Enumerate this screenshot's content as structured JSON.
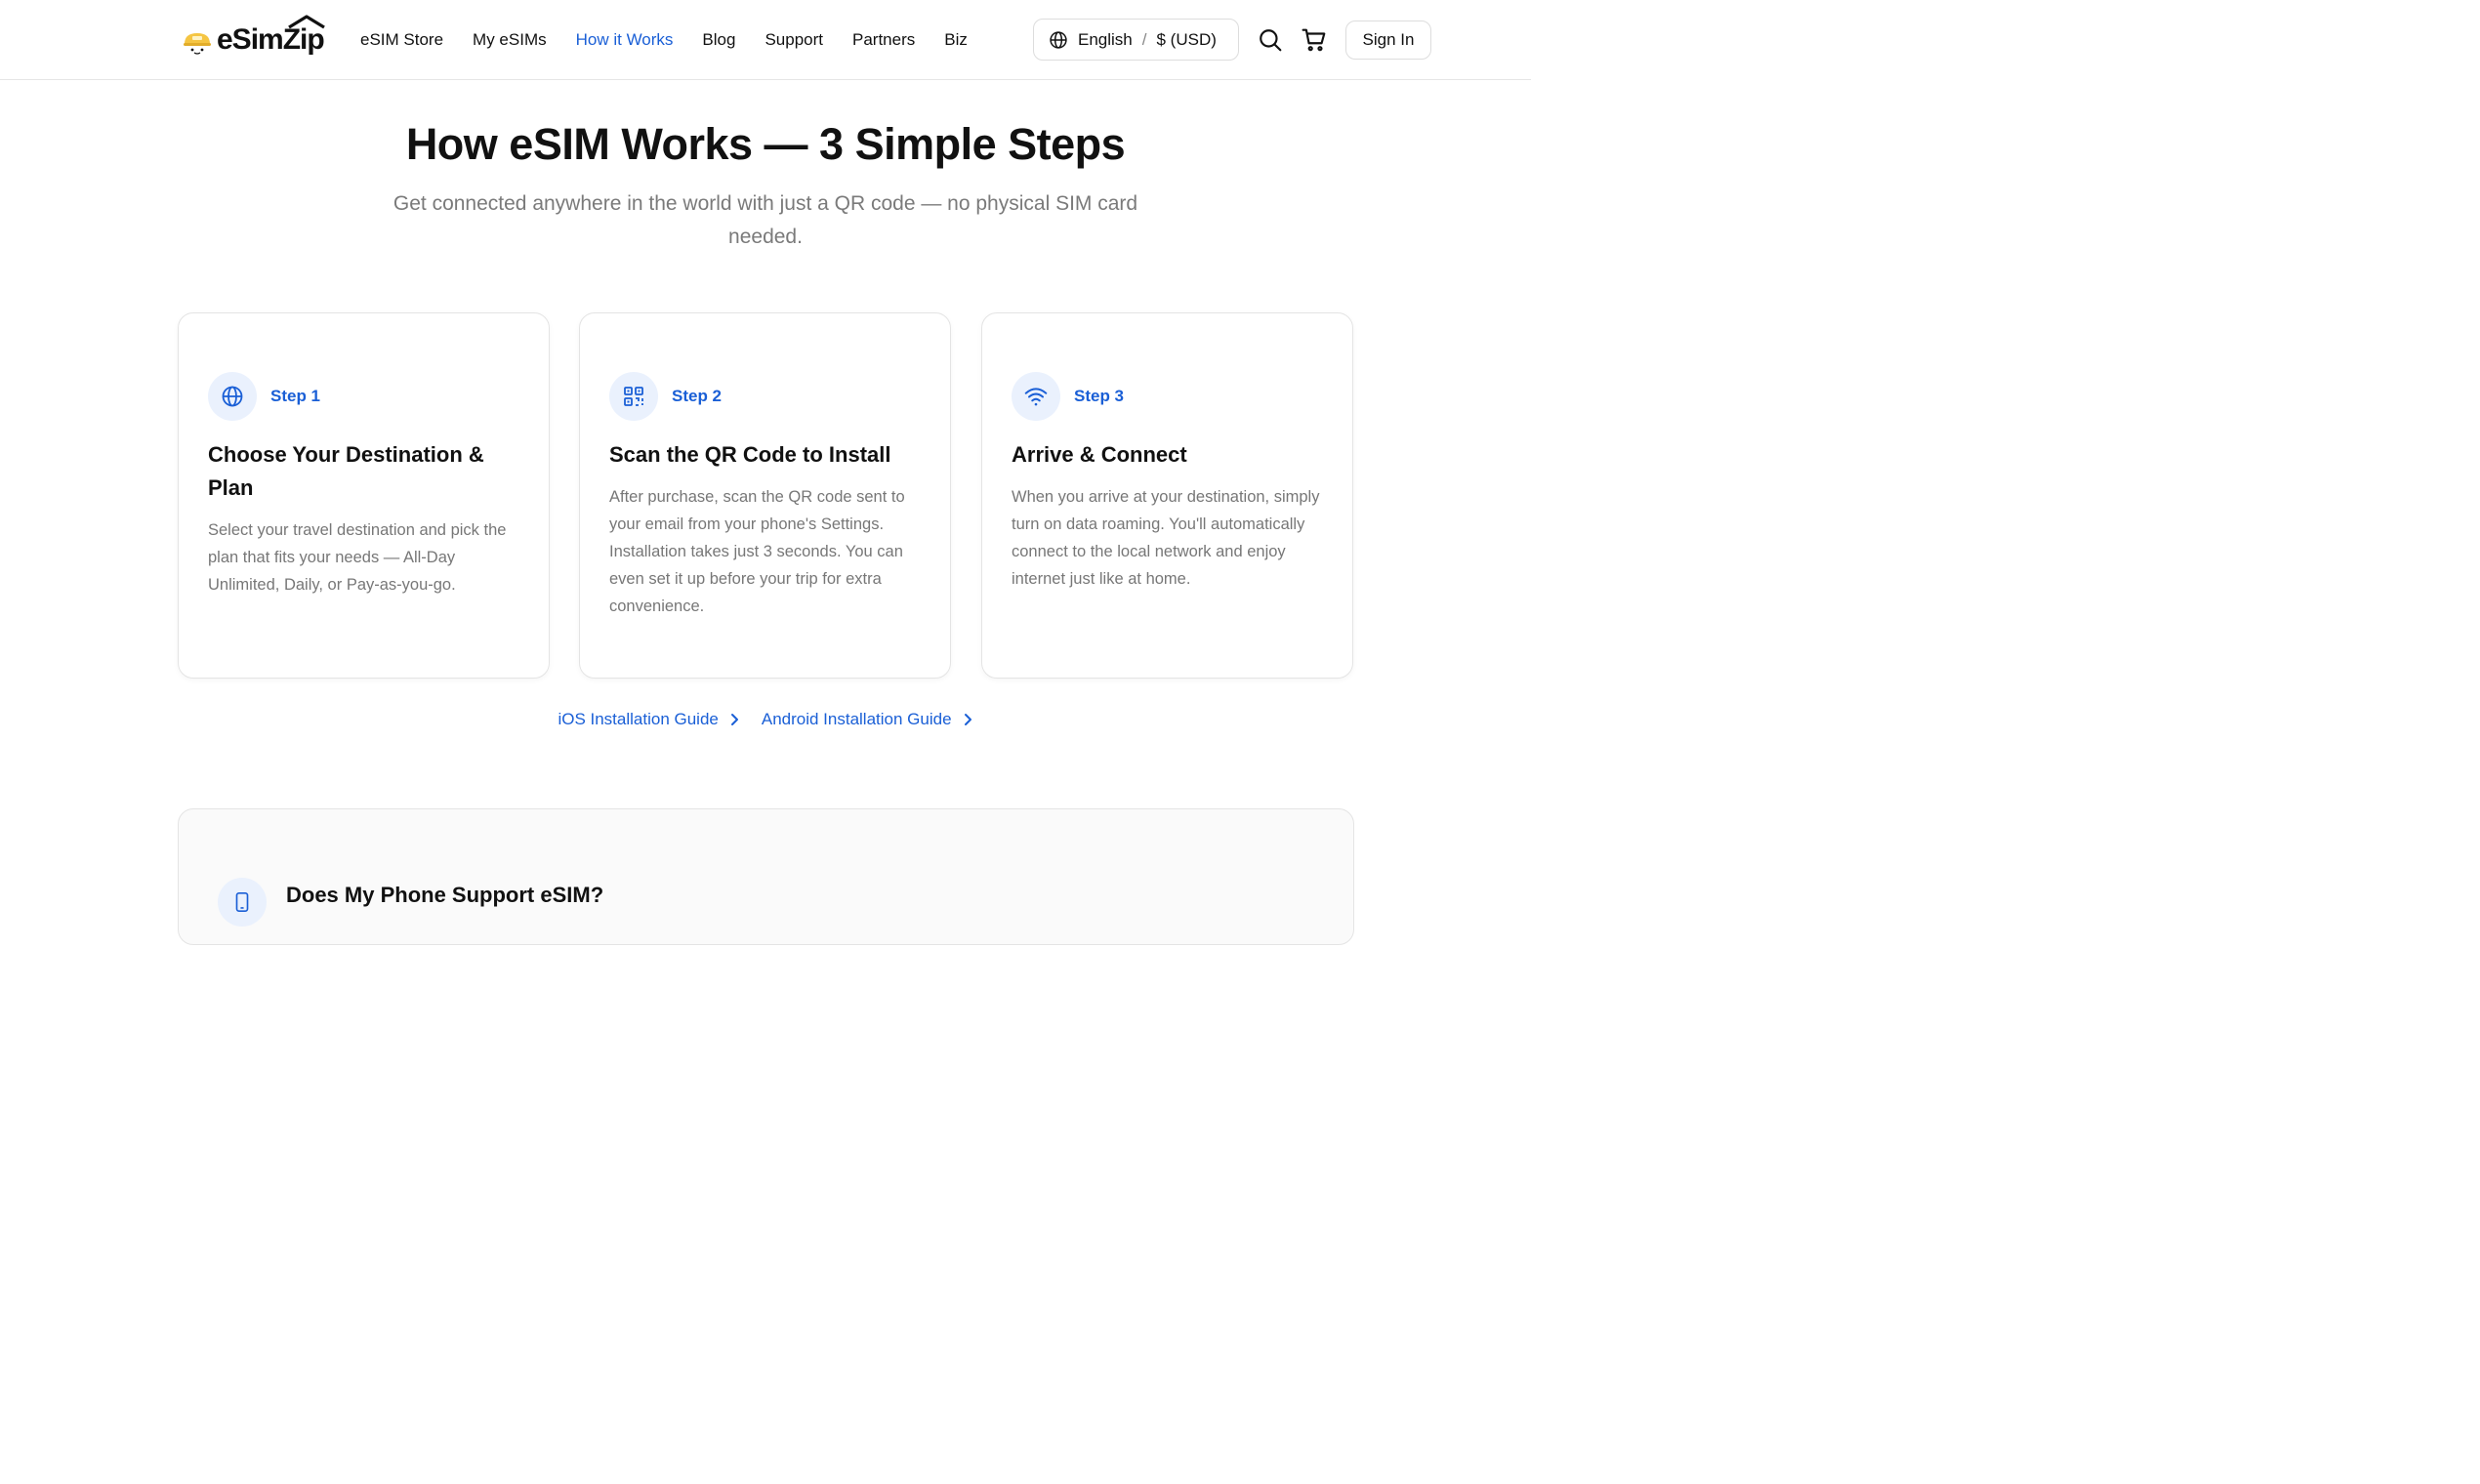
{
  "header": {
    "logo_text": "eSimZip",
    "nav": [
      {
        "label": "eSIM Store",
        "active": false
      },
      {
        "label": "My eSIMs",
        "active": false
      },
      {
        "label": "How it Works",
        "active": true
      },
      {
        "label": "Blog",
        "active": false
      },
      {
        "label": "Support",
        "active": false
      },
      {
        "label": "Partners",
        "active": false
      },
      {
        "label": "Biz",
        "active": false
      }
    ],
    "language": "English",
    "currency": "$ (USD)",
    "language_separator": "/",
    "sign_in_label": "Sign In"
  },
  "hero": {
    "title": "How eSIM Works — 3 Simple Steps",
    "subtitle": "Get connected anywhere in the world with just a QR code — no physical SIM card needed."
  },
  "steps": [
    {
      "icon": "globe-icon",
      "label": "Step 1",
      "title": "Choose Your Destination & Plan",
      "description": "Select your travel destination and pick the plan that fits your needs — All-Day Unlimited, Daily, or Pay-as-you-go."
    },
    {
      "icon": "qr-code-icon",
      "label": "Step 2",
      "title": "Scan the QR Code to Install",
      "description": "After purchase, scan the QR code sent to your email from your phone's Settings. Installation takes just 3 seconds. You can even set it up before your trip for extra convenience."
    },
    {
      "icon": "wifi-icon",
      "label": "Step 3",
      "title": "Arrive & Connect",
      "description": "When you arrive at your destination, simply turn on data roaming. You'll automatically connect to the local network and enjoy internet just like at home."
    }
  ],
  "guides": {
    "ios_label": "iOS Installation Guide",
    "android_label": "Android Installation Guide"
  },
  "support": {
    "title": "Does My Phone Support eSIM?"
  },
  "colors": {
    "accent": "#1a5fd6",
    "icon_bg": "#eaf1fd",
    "text": "#111111",
    "muted": "#777777"
  }
}
